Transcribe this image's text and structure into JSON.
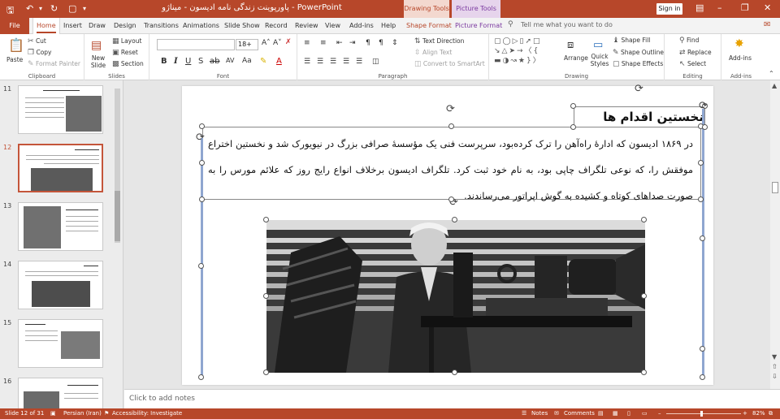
{
  "titlebar": {
    "title": "پاورپوینت زندگی نامه ادیسون - میناژو  -  PowerPoint",
    "ctx_drawing": "Drawing Tools",
    "ctx_picture": "Picture Tools",
    "signin": "Sign in"
  },
  "tabs": {
    "file": "File",
    "home": "Home",
    "insert": "Insert",
    "draw": "Draw",
    "design": "Design",
    "transitions": "Transitions",
    "animations": "Animations",
    "slideshow": "Slide Show",
    "record": "Record",
    "review": "Review",
    "view": "View",
    "addins": "Add-ins",
    "help": "Help",
    "shapeformat": "Shape Format",
    "pictureformat": "Picture Format",
    "tellme": "Tell me what you want to do"
  },
  "ribbon": {
    "clipboard": {
      "label": "Clipboard",
      "paste": "Paste",
      "cut": "Cut",
      "copy": "Copy",
      "format_painter": "Format Painter"
    },
    "slides": {
      "label": "Slides",
      "new_slide": "New Slide",
      "layout": "Layout",
      "reset": "Reset",
      "section": "Section"
    },
    "font": {
      "label": "Font",
      "font_name": "",
      "font_size": "18+"
    },
    "paragraph": {
      "label": "Paragraph",
      "text_direction": "Text Direction",
      "align_text": "Align Text",
      "convert_smartart": "Convert to SmartArt"
    },
    "drawing": {
      "label": "Drawing",
      "arrange": "Arrange",
      "quick_styles": "Quick Styles",
      "shape_fill": "Shape Fill",
      "shape_outline": "Shape Outline",
      "shape_effects": "Shape Effects"
    },
    "editing": {
      "label": "Editing",
      "find": "Find",
      "replace": "Replace",
      "select": "Select"
    },
    "addins": {
      "label": "Add-ins",
      "addins_btn": "Add-ins"
    }
  },
  "thumbnails": [
    {
      "num": "11"
    },
    {
      "num": "12"
    },
    {
      "num": "13"
    },
    {
      "num": "14"
    },
    {
      "num": "15"
    },
    {
      "num": "16"
    }
  ],
  "slide": {
    "title": "نخستین اقدام ها",
    "body": "در ۱۸۶۹ ادیسون که ادارهٔ راه‌آهن را ترک کرده‌بود، سرپرست فنی یک مؤسسهٔ صرافی بزرگ در نیویورک شد و نخستین اختراع موفقش را، که نوعی تلگراف چاپی بود، به نام خود ثبت کرد. تلگراف ادیسون برخلاف انواع رایج روز که علائم مورس را به صورت صداهای کوتاه و کشیده به گوش اپراتور می‌رساندند."
  },
  "notes": {
    "placeholder": "Click to add notes"
  },
  "status": {
    "slide": "Slide 12 of 31",
    "language": "Persian (Iran)",
    "accessibility": "Accessibility: Investigate",
    "notes": "Notes",
    "comments": "Comments",
    "zoom": "82%"
  }
}
